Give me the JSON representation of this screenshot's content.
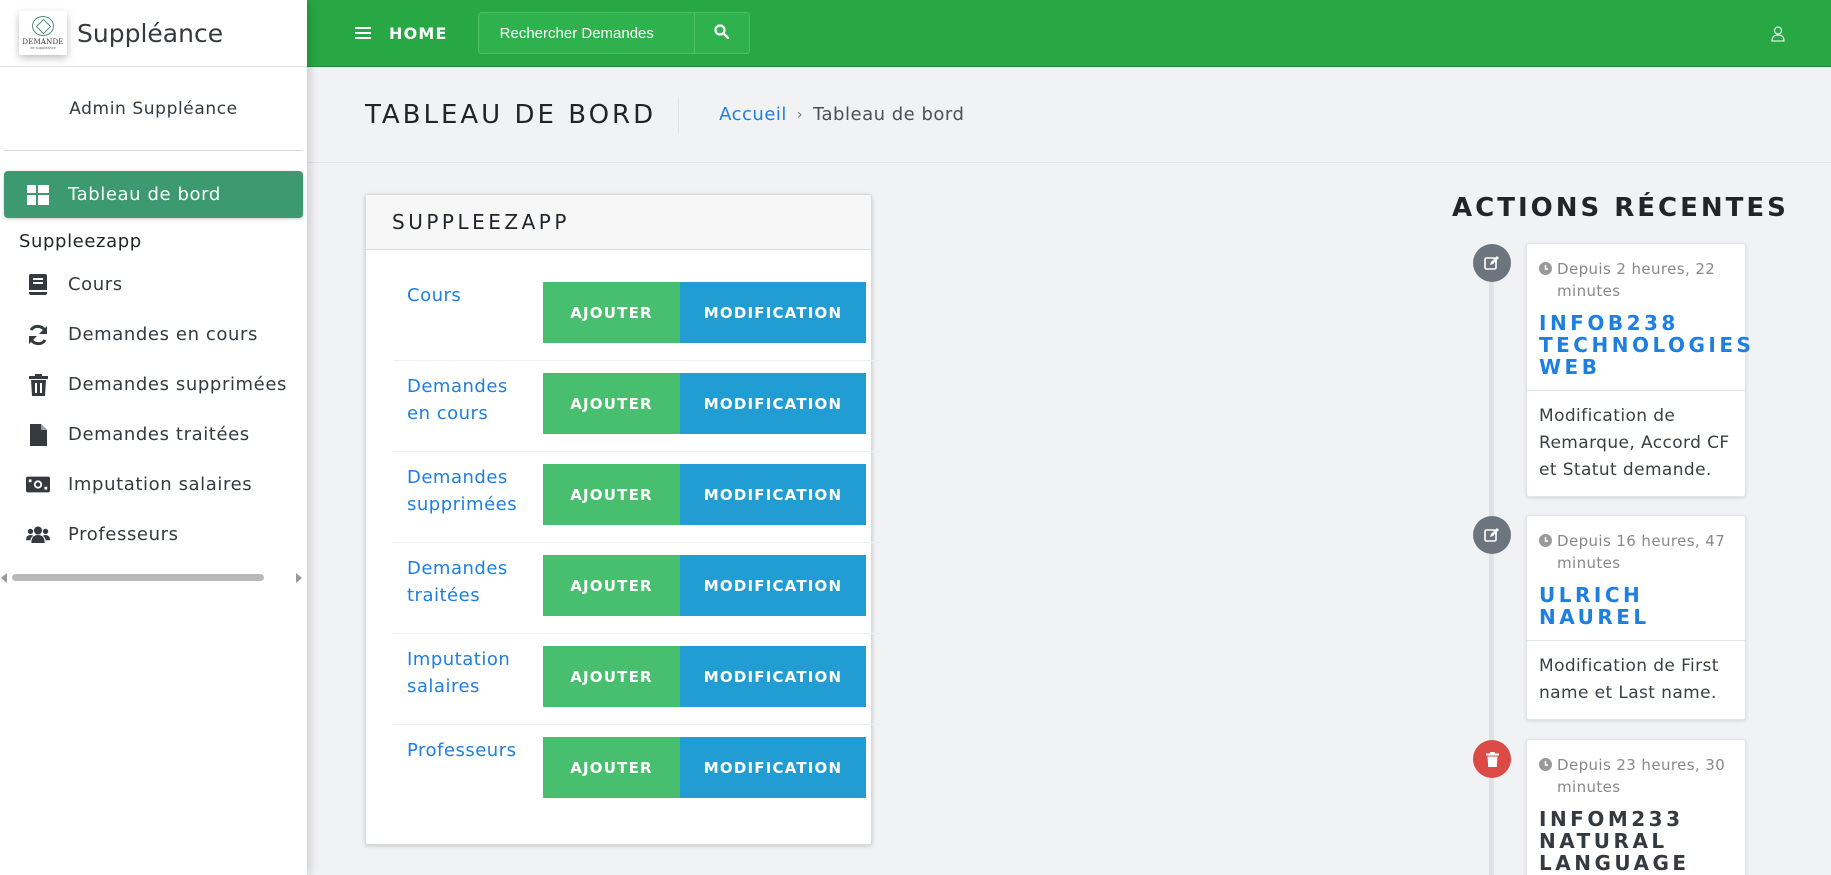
{
  "brand": {
    "title": "Suppléance",
    "logo_word": "DEMANDE",
    "logo_sub": "de suppléance"
  },
  "user": {
    "name": "Admin Suppléance"
  },
  "sidebar": {
    "active_item": {
      "label": "Tableau de bord",
      "icon": "dashboard-icon"
    },
    "section_header": "Suppleezapp",
    "items": [
      {
        "label": "Cours",
        "icon": "book-icon"
      },
      {
        "label": "Demandes en cours",
        "icon": "sync-icon"
      },
      {
        "label": "Demandes supprimées",
        "icon": "trash-icon"
      },
      {
        "label": "Demandes traitées",
        "icon": "file-icon"
      },
      {
        "label": "Imputation salaires",
        "icon": "money-icon"
      },
      {
        "label": "Professeurs",
        "icon": "users-icon"
      }
    ]
  },
  "topbar": {
    "home_label": "HOME",
    "search_placeholder": "Rechercher Demandes",
    "color": "#28a745"
  },
  "header": {
    "title": "TABLEAU DE BORD",
    "breadcrumb": {
      "home": "Accueil",
      "separator": "›",
      "current": "Tableau de bord"
    }
  },
  "module": {
    "title": "SUPPLEEZAPP",
    "add_label": "AJOUTER",
    "modify_label": "MODIFICATION",
    "rows": [
      {
        "label": "Cours"
      },
      {
        "label": "Demandes en cours"
      },
      {
        "label": "Demandes supprimées"
      },
      {
        "label": "Demandes traitées"
      },
      {
        "label": "Imputation salaires"
      },
      {
        "label": "Professeurs"
      }
    ]
  },
  "recent": {
    "title": "ACTIONS RÉCENTES",
    "items": [
      {
        "type": "edit",
        "icon": "edit-icon",
        "time": "Depuis 2 heures, 22 minutes",
        "name": "INFOB238 TECHNOLOGIES WEB",
        "description": "Modification de Remarque, Accord CF et Statut demande."
      },
      {
        "type": "edit",
        "icon": "edit-icon",
        "time": "Depuis 16 heures, 47 minutes",
        "name": "ULRICH NAUREL",
        "description": "Modification de First name et Last name."
      },
      {
        "type": "delete",
        "icon": "trash-icon",
        "time": "Depuis 23 heures, 30 minutes",
        "name": "INFOM233 NATURAL LANGUAGE"
      }
    ]
  },
  "colors": {
    "sidebar_active": "#3d9970",
    "add_button": "#48bf6e",
    "modify_button": "#229dd3",
    "link": "#1e7fe0",
    "delete": "#dc3545",
    "edit": "#6c757d"
  }
}
